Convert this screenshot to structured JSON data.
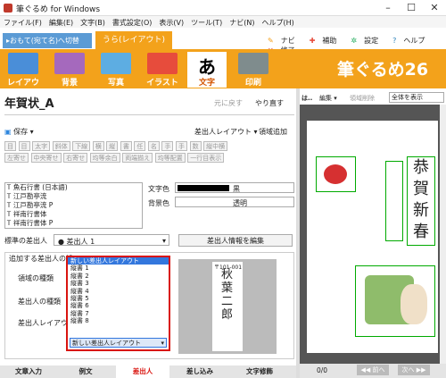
{
  "window": {
    "title": "筆ぐるめ for Windows",
    "controls": [
      "–",
      "☐",
      "✕"
    ]
  },
  "menu": [
    "ファイル(F)",
    "編集(E)",
    "文字(B)",
    "書式設定(O)",
    "表示(V)",
    "ツール(T)",
    "ナビ(N)",
    "ヘルプ(H)"
  ],
  "mode": {
    "switch_label": "▸おもて(宛て名)へ切替",
    "current_tab": "うら(レイアウト)"
  },
  "top_links": [
    "ナビ",
    "補助",
    "設定",
    "ヘルプ",
    "終了"
  ],
  "ribbon": {
    "buttons": [
      "レイアウト",
      "背景",
      "写真",
      "イラスト",
      "文字",
      "印刷"
    ],
    "active": "文字",
    "logo": "筆ぐるめ26"
  },
  "doc": {
    "title": "年賀状_A",
    "undo": "元に戻す",
    "redo": "やり直す",
    "save": "保存 ▾",
    "sender_layout": "差出人レイアウト ▾",
    "add_region": "領域追加"
  },
  "format_buttons": [
    [
      "目",
      "目",
      "太字",
      "斜体",
      "下線",
      "横",
      "縦",
      "書",
      "任",
      "名",
      "手",
      "手",
      "数",
      "縦中横"
    ],
    [
      "左寄せ",
      "中央寄せ",
      "右寄せ",
      "均等余白",
      "両端揃え",
      "均等配置",
      "一行目表示"
    ]
  ],
  "fonts": [
    "魚石行書 (日本語)",
    "江戸勘亭流",
    "江戸勘亭流 P",
    "祥南行書体",
    "祥南行書体 P"
  ],
  "text_color": {
    "label": "文字色",
    "value": "黒"
  },
  "bg_color": {
    "label": "背景色",
    "value": "透明"
  },
  "standard_sender": {
    "label": "標準の差出人",
    "value": "● 差出人 1",
    "edit_button": "差出人情報を編集"
  },
  "add_sender": {
    "label": "追加する差出人の設",
    "area_label": "領域の種類",
    "kind_label": "差出人の種類",
    "layout_label": "差出人レイアウト"
  },
  "dropdown": {
    "items": [
      "新しい差出人レイアウト",
      "縦書 1",
      "縦書 2",
      "縦書 3",
      "縦書 4",
      "縦書 5",
      "縦書 6",
      "縦書 7",
      "縦書 8"
    ],
    "highlighted": "新しい差出人レイアウト",
    "current": "新しい差出人レイアウト"
  },
  "preview": {
    "postal": "〒101-001",
    "name": "秋葉二郎"
  },
  "bottom_tabs": [
    "文章入力",
    "例文",
    "差出人",
    "差し込み",
    "文字修飾"
  ],
  "bottom_tabs_active": "差出人",
  "right": {
    "toolbar": {
      "menu": "は..",
      "edit": "編集 ▾",
      "delete": "領域削除",
      "view": "全体を表示"
    },
    "page": "0/0",
    "prev": "◀◀ 前へ",
    "next": "次へ ▶▶",
    "card_text": "恭賀新春"
  }
}
